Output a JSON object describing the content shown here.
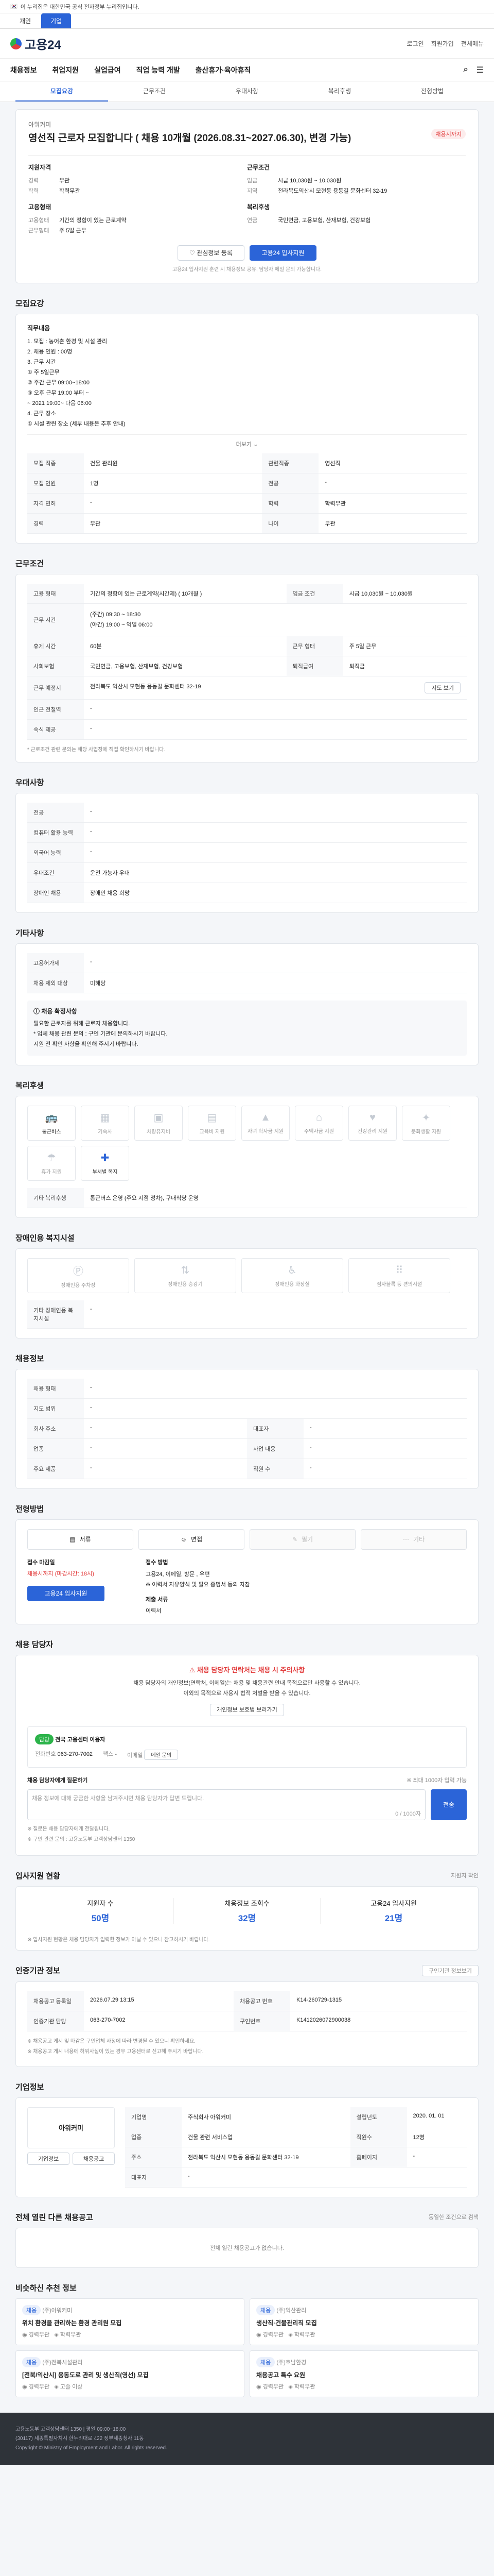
{
  "gov_banner": "이 누리집은 대한민국 공식 전자정부 누리집입니다.",
  "top_tabs": [
    "개인",
    "기업"
  ],
  "header": {
    "logo": "고용24",
    "links": [
      "로그인",
      "회원가입",
      "전체메뉴"
    ]
  },
  "gnb": [
    "채용정보",
    "취업지원",
    "실업급여",
    "직업 능력 개발",
    "출산휴가·육아휴직"
  ],
  "page_tabs": [
    "모집요강",
    "근무조건",
    "우대사항",
    "복리후생",
    "전형방법"
  ],
  "title": {
    "company": "아워커미",
    "name": "영선직 근로자 모집합니다 ( 채용 10개월 (2026.08.31~2027.06.30), 변경 가능)",
    "dday": "채용시까지",
    "left_heading": "지원자격",
    "right_heading": "근무조건",
    "left_rows": [
      {
        "k": "경력",
        "v": "무관"
      },
      {
        "k": "학력",
        "v": "학력무관"
      }
    ],
    "right_rows": [
      {
        "k": "임금",
        "v": "시급 10,030원 ~ 10,030원"
      },
      {
        "k": "지역",
        "v": "전라북도익산시 모현동 용동길 문화센터 32-19"
      }
    ],
    "left_heading2": "고용형태",
    "right_heading2": "복리후생",
    "left_rows2": [
      {
        "k": "고용형태",
        "v": "기간의 정함이 있는 근로계약"
      },
      {
        "k": "근무형태",
        "v": "주 5일 근무"
      }
    ],
    "right_rows2": [
      {
        "k": "연금",
        "v": "국민연금, 고용보험, 산재보험, 건강보험"
      }
    ],
    "btn_scrap": "관심정보 등록",
    "btn_apply": "고용24 입사지원",
    "notice": "고용24 입사지원 훈련 시 채용정보 공유, 담당자 메일 문의 가능합니다."
  },
  "recruit": {
    "heading": "모집요강",
    "duty_label": "직무내용",
    "duty_text": "1. 모집 : 농어촌 환경 및 시설 관리\n2. 채용 인원 : 00명\n3. 근무 시간\n  ① 주 5일근무\n  ② 주간 근무 09:00~18:00\n  ③ 오후 근무 19:00 부터 ~\n  ~ 2021 19:00~ 다음 06:00\n4. 근무 장소\n  ① 시설 관련 장소 (세부 내용은 추후 안내)",
    "more": "더보기",
    "rows": [
      {
        "k": "모집 직종",
        "v": "건물 관리원",
        "k2": "관련직종",
        "v2": "영선직"
      },
      {
        "k": "모집 인원",
        "v": "1명",
        "k2": "전공",
        "v2": "-"
      },
      {
        "k": "자격 면허",
        "v": "-",
        "k2": "학력",
        "v2": "학력무관"
      },
      {
        "k": "경력",
        "v": "무관",
        "k2": "나이",
        "v2": "무관"
      }
    ]
  },
  "conditions": {
    "heading": "근무조건",
    "rows": [
      {
        "k": "고용 형태",
        "v": "기간의 정함이 있는 근로계약(시간제) ( 10개월 )",
        "k2": "임금 조건",
        "v2": "시급 10,030원 ~ 10,030원"
      },
      {
        "k": "근무 시간",
        "v": "(주간) 09:30 ~ 18:30\n(야간) 19:00 ~ 익일 06:00",
        "k2": "",
        "v2": ""
      },
      {
        "k": "휴게 시간",
        "v": "60분",
        "k2": "근무 형태",
        "v2": "주 5일 근무"
      },
      {
        "k": "사회보험",
        "v": "국민연금, 고용보험, 산재보험, 건강보험",
        "k2": "퇴직급여",
        "v2": "퇴직금"
      },
      {
        "k": "근무 예정지",
        "v": "전라북도 익산시 모현동 용동길 문화센터 32-19",
        "k2": "",
        "v2": ""
      },
      {
        "k": "인근 전철역",
        "v": "-",
        "k2": "",
        "v2": ""
      },
      {
        "k": "숙식 제공",
        "v": "-",
        "k2": "",
        "v2": ""
      }
    ],
    "map_btn": "지도 보기",
    "note": "* 근로조건 관련 문의는 해당 사업장에 직접 확인하시기 바랍니다."
  },
  "preferences": {
    "heading": "우대사항",
    "rows": [
      {
        "k": "전공",
        "v": "-"
      },
      {
        "k": "컴퓨터 활용 능력",
        "v": "-"
      },
      {
        "k": "외국어 능력",
        "v": "-"
      },
      {
        "k": "우대조건",
        "v": "운전 가능자 우대"
      },
      {
        "k": "장애인 채용",
        "v": "장애인 채용 희망"
      }
    ]
  },
  "other": {
    "heading": "기타사항",
    "rows": [
      {
        "k": "고용허가제",
        "v": "-"
      },
      {
        "k": "채용 제외 대상",
        "v": "미해당"
      }
    ],
    "info_title": "채용 확정사항",
    "info_text": "필요한 근로자를 위해 근로자 채용합니다.\n* 업체 채용 관련 문의 : 구인 기관에 문의하시기 바랍니다.\n지원 전 확인 사항을 확인해 주시기 바랍니다."
  },
  "welfare": {
    "heading": "복리후생",
    "items": [
      {
        "label": "통근버스",
        "on": true
      },
      {
        "label": "기숙사",
        "on": false
      },
      {
        "label": "차량유지비",
        "on": false
      },
      {
        "label": "교육비 지원",
        "on": false
      },
      {
        "label": "자녀 학자금 지원",
        "on": false
      },
      {
        "label": "주택자금 지원",
        "on": false
      },
      {
        "label": "건강관리 지원",
        "on": false
      },
      {
        "label": "문화생활 지원",
        "on": false
      },
      {
        "label": "휴가 지원",
        "on": false
      },
      {
        "label": "부서별 복지",
        "on": true
      }
    ],
    "extra_label": "기타 복리후생",
    "extra_text": "통근버스 운영 (주요 지점 정차), 구내식당 운영"
  },
  "disability": {
    "heading": "장애인용 복지시설",
    "items": [
      "장애인용 주차장",
      "장애인용 승강기",
      "장애인용 화장실",
      "점자블록 등 편의시설"
    ],
    "extra_label": "기타 장애인용 복지시설",
    "extra_text": "-"
  },
  "hiring": {
    "heading": "채용정보",
    "rows": [
      {
        "k": "채용 형태",
        "v": "-"
      },
      {
        "k": "지도 범위",
        "v": "-",
        "k2": "",
        "v2": ""
      },
      {
        "k": "회사 주소",
        "v": "-",
        "k2": "대표자",
        "v2": "-"
      },
      {
        "k": "업종",
        "v": "-",
        "k2": "사업 내용",
        "v2": "-"
      },
      {
        "k": "주요 제품",
        "v": "-",
        "k2": "직원 수",
        "v2": "-"
      }
    ]
  },
  "apply": {
    "heading": "전형방법",
    "options": [
      {
        "label": "서류",
        "on": true
      },
      {
        "label": "면접",
        "on": true
      },
      {
        "label": "필기",
        "on": false
      },
      {
        "label": "기타",
        "on": false
      }
    ],
    "period_label": "접수 마감일",
    "period_value": "채용시까지 (마감시간: 18시)",
    "method_label": "접수 방법",
    "method_value": "고용24, 이메일, 방문 , 우편\n ※ 이력서 자유양식 및 필요 증명서 등의 지참",
    "docs_label": "제출 서류",
    "docs_value": "이력서",
    "apply_btn": "고용24 입사지원"
  },
  "contact": {
    "heading": "채용 담당자",
    "warn_lead": "채용 담당자 연락처는 채용 시 주의사항",
    "warn_text": "채용 담당자의 개인정보(연락처, 이메일)는 채용 및 채용관련 안내 목적으로만 사용할 수 있습니다.\n이외의 목적으로 사용시 법적 처벌을 받을 수 있습니다.",
    "warn_btn": "개인정보 보호법 보러가기",
    "person_tag": "담당",
    "person_name": "전국 고용센터 이용자",
    "dept": "전화번호",
    "phone": "063-270-7002",
    "fax_label": "팩스",
    "fax": "-",
    "email_label": "이메일",
    "email_btn": "메일 문의",
    "inquiry_label": "채용 담당자에게 질문하기",
    "inquiry_hint": "※ 최대 1000자 입력 가능",
    "inquiry_placeholder": "채용 정보에 대해 궁금한 사항을 남겨주시면 채용 담당자가 답변 드립니다.",
    "counter": "0 / 1000자",
    "send_btn": "전송",
    "notes": "※ 질문은 채용 담당자에게 전달됩니다.\n※ 구인 관련 문의 : 고용노동부 고객상담센터 1350"
  },
  "stats": {
    "heading": "입사지원 현황",
    "link": "지원자 확인",
    "items": [
      {
        "label": "지원자 수",
        "value": "50명"
      },
      {
        "label": "채용정보 조회수",
        "value": "32명"
      },
      {
        "label": "고용24 입사지원",
        "value": "21명"
      }
    ],
    "note": "※ 입사지원 현황은 채용 담당자가 입력한 정보가 아닐 수 있으니 참고하시기 바랍니다."
  },
  "agency": {
    "heading": "인증기관 정보",
    "btn": "구인기관 정보보기",
    "rows": [
      {
        "k": "채용공고 등록일",
        "v": "2026.07.29 13:15",
        "k2": "채용공고 번호",
        "v2": "K14-260729-1315"
      },
      {
        "k": "인증기관 담당",
        "v": "063-270-7002",
        "k2": "구인번호",
        "v2": "K1412026072900038"
      }
    ],
    "notes": "※ 채용공고 게시 및 마감은 구인업체 사정에 따라 변경될 수 있으니 확인하세요.\n※ 채용공고 게시 내용에 허위사실이 있는 경우 고용센터로 신고해 주시기 바랍니다."
  },
  "company": {
    "heading": "기업정보",
    "name": "아워커미",
    "btn_info": "기업정보",
    "btn_jobs": "채용공고",
    "rows": [
      {
        "k": "기업명",
        "v": "주식회사 아워커미",
        "k2": "설립년도",
        "v2": "2020. 01. 01"
      },
      {
        "k": "업종",
        "v": "건물 관련 서비스업",
        "k2": "직원수",
        "v2": "12명"
      },
      {
        "k": "주소",
        "v": "전라북도 익산시 모현동 용동길 문화센터 32-19",
        "k2": "홈페이지",
        "v2": "-"
      },
      {
        "k": "대표자",
        "v": "-",
        "k2": "",
        "v2": ""
      }
    ]
  },
  "similar": {
    "heading": "전체 열린 다른 채용공고",
    "right": "동일한 조건으로 검색",
    "empty": "전체 열린 채용공고가 없습니다."
  },
  "related": {
    "heading": "비슷하신 추천 정보",
    "items": [
      {
        "tag": "채용",
        "org": "(주)아워커미",
        "title": "위치 환경을 관리하는 환경 관리원 모집",
        "a": "경력무관",
        "b": "학력무관"
      },
      {
        "tag": "채용",
        "org": "(주)익산관리",
        "title": "생산직·건물관리직 모집",
        "a": "경력무관",
        "b": "학력무관"
      },
      {
        "tag": "채용",
        "org": "(주)전북시설관리",
        "title": "[전북/익산시] 용동도로 관리 및 생산직(영선) 모집",
        "a": "경력무관",
        "b": "고졸 이상"
      },
      {
        "tag": "채용",
        "org": "(주)호남환경",
        "title": "채용공고 특수 요원",
        "a": "경력무관",
        "b": "학력무관"
      }
    ]
  },
  "footer": {
    "line1": "고용노동부 고객상담센터 1350 | 평일 09:00~18:00",
    "line2": "(30117) 세종특별자치시 한누리대로 422 정부세종청사 11동",
    "line3": "Copyright © Ministry of Employment and Labor. All rights reserved."
  }
}
